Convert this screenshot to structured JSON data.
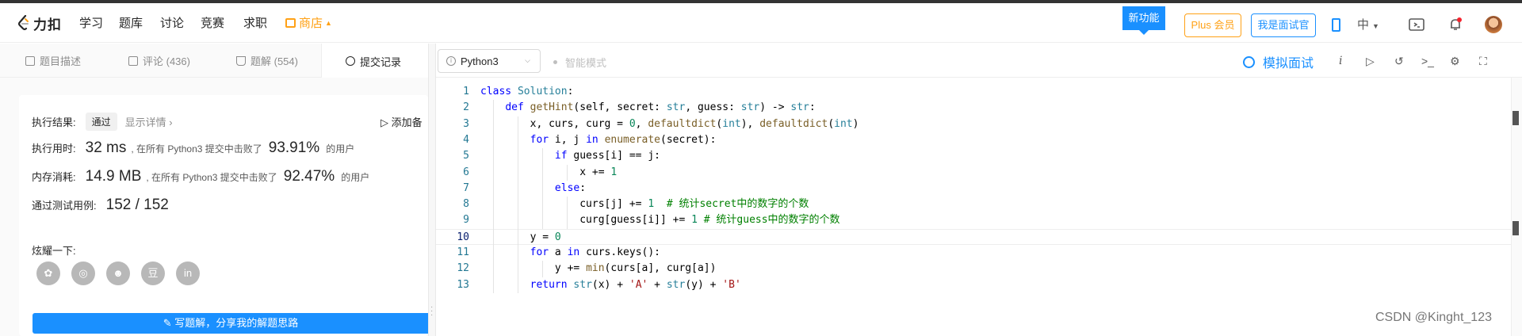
{
  "nav": {
    "brand": "力扣",
    "items": [
      "学习",
      "题库",
      "讨论",
      "竞赛",
      "求职"
    ],
    "store": "商店",
    "new_feature": "新功能",
    "plus": "Plus 会员",
    "interviewer": "我是面试官",
    "language": "中",
    "icons": [
      "code-playground-icon",
      "bell-icon",
      "avatar"
    ],
    "colors": {
      "accent": "#1a90ff",
      "store": "#ffa116"
    }
  },
  "left_tabs": [
    {
      "label": "题目描述",
      "icon": "description-icon"
    },
    {
      "label": "评论 (436)",
      "icon": "comment-icon"
    },
    {
      "label": "题解 (554)",
      "icon": "flask-icon"
    },
    {
      "label": "提交记录",
      "icon": "clock-icon",
      "active": true
    }
  ],
  "result": {
    "status_label": "执行结果:",
    "status": "通过",
    "details_link": "显示详情 ›",
    "add_note": "添加备",
    "runtime_label": "执行用时:",
    "runtime": "32 ms",
    "runtime_text": ", 在所有 Python3 提交中击败了",
    "runtime_pct": "93.91%",
    "users_text": "的用户",
    "memory_label": "内存消耗:",
    "memory": "14.9 MB",
    "memory_text": ", 在所有 Python3 提交中击败了",
    "memory_pct": "92.47%",
    "tests_label": "通过测试用例:",
    "tests": "152 / 152",
    "share_label": "炫耀一下:",
    "share_icons": [
      "wechat-icon",
      "weibo-icon",
      "qq-icon",
      "douban-icon",
      "linkedin-icon"
    ],
    "share_glyphs": [
      "✿",
      "◎",
      "☻",
      "豆",
      "in"
    ],
    "write_button": "写题解，分享我的解题思路"
  },
  "editor": {
    "language": "Python3",
    "smart_mode": "智能模式",
    "mock_interview": "模拟面试",
    "tool_icons": [
      "info-icon",
      "run-icon",
      "reset-icon",
      "console-icon",
      "settings-icon",
      "fullscreen-icon"
    ],
    "current_line": 10,
    "code": [
      "class Solution:",
      "    def getHint(self, secret: str, guess: str) -> str:",
      "        x, curs, curg = 0, defaultdict(int), defaultdict(int)",
      "        for i, j in enumerate(secret):",
      "            if guess[i] == j:",
      "                x += 1",
      "            else:",
      "                curs[j] += 1  # 统计secret中的数字的个数",
      "                curg[guess[i]] += 1 # 统计guess中的数字的个数",
      "        y = 0",
      "        for a in curs.keys():",
      "            y += min(curs[a], curg[a])",
      "        return str(x) + 'A' + str(y) + 'B'"
    ]
  },
  "watermark": "CSDN @Kinght_123"
}
